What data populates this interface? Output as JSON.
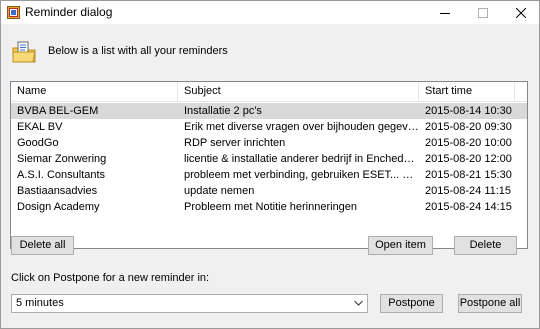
{
  "window": {
    "title": "Reminder dialog",
    "icon": "reminder-app-icon"
  },
  "header": {
    "text": "Below is a list with all your reminders",
    "icon": "folder-note-icon"
  },
  "list": {
    "columns": [
      "Name",
      "Subject",
      "Start time"
    ],
    "rows": [
      {
        "name": "BVBA BEL-GEM",
        "subject": "Installatie 2 pc's",
        "start": "2015-08-14 10:30"
      },
      {
        "name": "EKAL BV",
        "subject": "Erik met diverse vragen over bijhouden gegevens...",
        "start": "2015-08-20 09:30"
      },
      {
        "name": "GoodGo",
        "subject": "RDP server inrichten",
        "start": "2015-08-20 10:00"
      },
      {
        "name": "Siemar Zonwering",
        "subject": "licentie & installatie anderer bedrijf in Enchede/A...",
        "start": "2015-08-20 12:00"
      },
      {
        "name": "A.S.I. Consultants",
        "subject": "probleem met verbinding, gebruiken ESET... 192....",
        "start": "2015-08-21 15:30"
      },
      {
        "name": "Bastiaansadvies",
        "subject": "update nemen",
        "start": "2015-08-24 11:15"
      },
      {
        "name": "Dosign Academy",
        "subject": "Probleem met Notitie herinneringen",
        "start": "2015-08-24 14:15"
      }
    ],
    "selected_index": 0
  },
  "buttons": {
    "delete_all": "Delete all",
    "open_item": "Open item",
    "delete": "Delete",
    "postpone": "Postpone",
    "postpone_all": "Postpone all"
  },
  "postpone": {
    "label": "Click on Postpone for a new reminder in:",
    "selected": "5 minutes"
  }
}
